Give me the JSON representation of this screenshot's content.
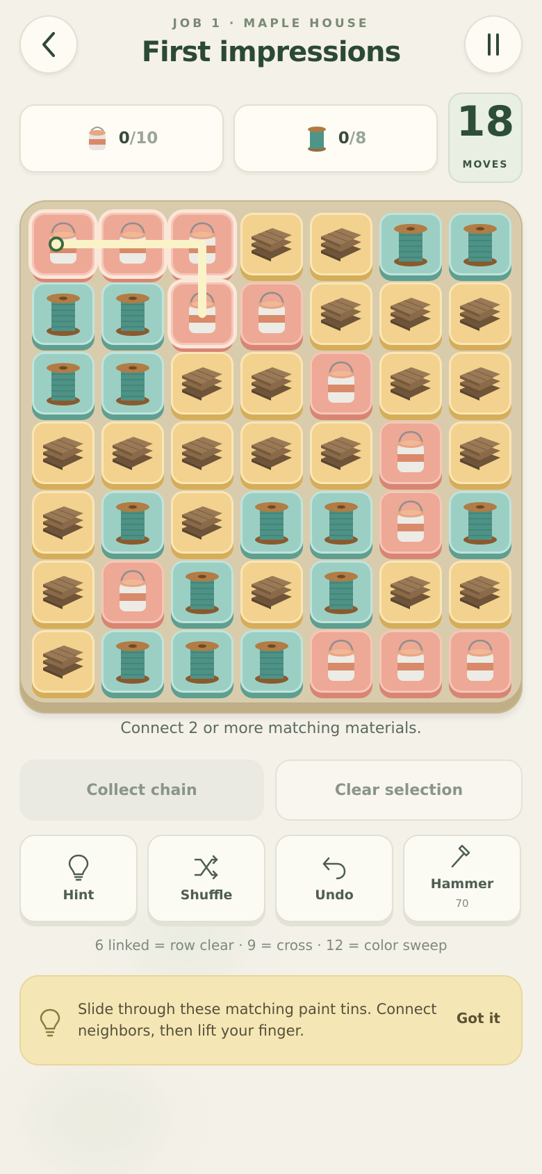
{
  "header": {
    "subtitle": "JOB 1 · MAPLE HOUSE",
    "title": "First impressions"
  },
  "goals": [
    {
      "icon": "paint-tin-icon",
      "current": "0",
      "total": "/10"
    },
    {
      "icon": "thread-spool-icon",
      "current": "0",
      "total": "/8"
    }
  ],
  "moves": {
    "count": "18",
    "label": "MOVES"
  },
  "board": {
    "legend": {
      "P": "paint-tin",
      "T": "thread-spool",
      "W": "wood-planks"
    },
    "rows": [
      [
        "P",
        "P",
        "P",
        "W",
        "W",
        "T",
        "T"
      ],
      [
        "T",
        "T",
        "P",
        "P",
        "W",
        "W",
        "W"
      ],
      [
        "T",
        "T",
        "W",
        "W",
        "P",
        "W",
        "W"
      ],
      [
        "W",
        "W",
        "W",
        "W",
        "W",
        "P",
        "W"
      ],
      [
        "W",
        "T",
        "W",
        "T",
        "T",
        "P",
        "T"
      ],
      [
        "W",
        "P",
        "T",
        "W",
        "T",
        "W",
        "W"
      ],
      [
        "W",
        "T",
        "T",
        "T",
        "P",
        "P",
        "P"
      ]
    ],
    "selected_chain": [
      [
        0,
        0
      ],
      [
        0,
        1
      ],
      [
        0,
        2
      ],
      [
        1,
        2
      ]
    ]
  },
  "instruction": "Connect 2 or more matching materials.",
  "actions": {
    "collect": "Collect chain",
    "clear": "Clear selection"
  },
  "tools": [
    {
      "icon": "lightbulb-icon",
      "label": "Hint",
      "count": ""
    },
    {
      "icon": "shuffle-icon",
      "label": "Shuffle",
      "count": ""
    },
    {
      "icon": "undo-icon",
      "label": "Undo",
      "count": ""
    },
    {
      "icon": "hammer-icon",
      "label": "Hammer",
      "count": "70"
    }
  ],
  "combo_hint": "6 linked = row clear · 9 = cross · 12 = color sweep",
  "tip": {
    "icon": "lightbulb-icon",
    "text": "Slide through these matching paint tins. Connect neighbors, then lift your finger.",
    "dismiss": "Got it"
  },
  "colors": {
    "background": "#f4f1e9",
    "title_green": "#2b4a35",
    "paint": "#eea896",
    "thread": "#9ccfc4",
    "wood": "#f2d28e",
    "tip_bg": "#f5e7b5"
  }
}
